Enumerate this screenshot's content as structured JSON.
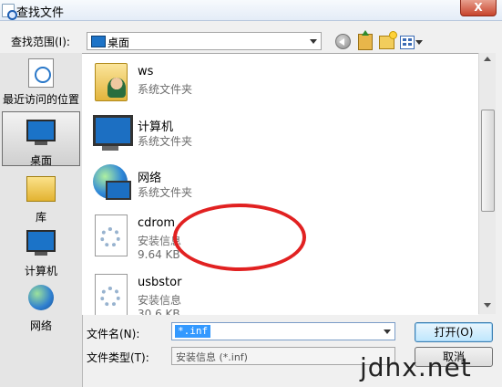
{
  "window": {
    "title": "查找文件",
    "close_label": "X"
  },
  "lookin": {
    "label": "查找范围(I):",
    "value": "桌面"
  },
  "toolbar": {
    "back_icon": "back-icon",
    "up_icon": "up-folder-icon",
    "new_folder_icon": "new-folder-icon",
    "views_icon": "views-menu-icon"
  },
  "places": [
    {
      "label": "最近访问的位置",
      "icon": "recent-places-icon"
    },
    {
      "label": "桌面",
      "icon": "desktop-icon",
      "selected": true
    },
    {
      "label": "库",
      "icon": "libraries-icon"
    },
    {
      "label": "计算机",
      "icon": "computer-icon"
    },
    {
      "label": "网络",
      "icon": "network-icon"
    }
  ],
  "files": [
    {
      "name": "ws",
      "type": "系统文件夹",
      "icon": "user-folder-icon"
    },
    {
      "name": "计算机",
      "type": "系统文件夹",
      "icon": "computer-icon"
    },
    {
      "name": "网络",
      "type": "系统文件夹",
      "icon": "network-icon"
    },
    {
      "name": "cdrom",
      "type": "安装信息",
      "size": "9.64 KB",
      "icon": "setup-info-icon"
    },
    {
      "name": "usbstor",
      "type": "安装信息",
      "size": "30.6 KB",
      "icon": "setup-info-icon"
    }
  ],
  "filename": {
    "label": "文件名(N):",
    "value": "*.inf"
  },
  "filetype": {
    "label": "文件类型(T):",
    "value": "安装信息 (*.inf)"
  },
  "buttons": {
    "open": "打开(O)",
    "cancel": "取消"
  },
  "watermark": "jdhx.net",
  "colors": {
    "highlight_circle": "#e12121",
    "selection": "#3399ff"
  }
}
